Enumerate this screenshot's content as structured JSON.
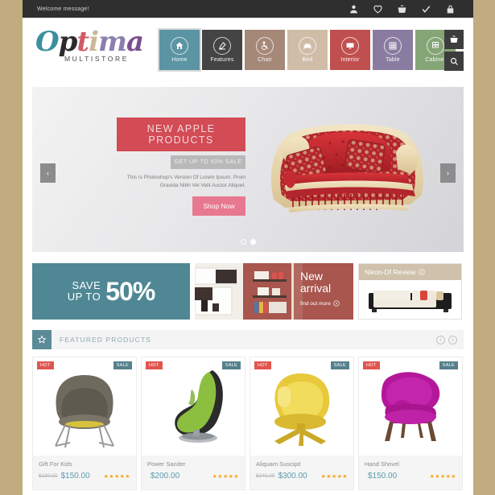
{
  "topbar": {
    "welcome": "Welcome message!",
    "icons": [
      {
        "name": "account-icon"
      },
      {
        "name": "wishlist-heart-icon"
      },
      {
        "name": "shopping-basket-icon"
      },
      {
        "name": "checkout-check-icon"
      },
      {
        "name": "login-lock-icon"
      }
    ]
  },
  "logo": {
    "letters": [
      "O",
      "p",
      "t",
      "i",
      "m",
      "a"
    ],
    "word": "Optima",
    "subtitle": "MULTISTORE"
  },
  "nav": {
    "items": [
      {
        "label": "Home",
        "icon": "home-icon",
        "color": "#5b94a3",
        "active": true
      },
      {
        "label": "Features",
        "icon": "edit-pencil-icon",
        "color": "#444444",
        "active": false
      },
      {
        "label": "Chair",
        "icon": "wheelchair-icon",
        "color": "#a68879",
        "active": false
      },
      {
        "label": "Bed",
        "icon": "bed-icon",
        "color": "#cfbda8",
        "active": false
      },
      {
        "label": "Interior",
        "icon": "monitor-icon",
        "color": "#c0504f",
        "active": false
      },
      {
        "label": "Table",
        "icon": "grid-table-icon",
        "color": "#8a7ca0",
        "active": false
      },
      {
        "label": "Cabinet",
        "icon": "cabinet-icon",
        "color": "#85a577",
        "active": false
      }
    ],
    "buttons": [
      {
        "name": "cart-button",
        "icon": "shopping-basket-icon"
      },
      {
        "name": "search-button",
        "icon": "search-icon"
      }
    ]
  },
  "hero": {
    "title": "NEW APPLE PRODUCTS",
    "subtitle": "GET UP TO 50% SALE",
    "body": "This Is Photoshop's Version Of Lorem Ipsum. Proin Gravida Nibh Vel Velit Auctor Aliquet.",
    "cta": "Shop Now",
    "prev": "‹",
    "next": "›",
    "dots": 2,
    "active_dot": 2,
    "image_alt": "red-ornate-sofa"
  },
  "promos": {
    "save": {
      "small_line1": "SAVE",
      "small_line2": "UP TO",
      "big": "50%",
      "color": "#4f8794"
    },
    "new_arrival": {
      "line1": "New",
      "line2": "arrival",
      "link": "find out more",
      "color": "#a8564e"
    },
    "nikon": {
      "title": "Nikon-Df Review",
      "image_alt": "black-white-modern-sofa"
    }
  },
  "featured": {
    "title": "FEATURED PRODUCTS",
    "star_icon": "star-icon",
    "prev": "‹",
    "next": "›"
  },
  "products": [
    {
      "name": "Gift For Kids",
      "old_price": "$180.00",
      "price": "$150.00",
      "badge_hot": "HOT",
      "badge_sale": "SALE",
      "stars": "★★★★★",
      "image_alt": "grey-womb-armchair"
    },
    {
      "name": "Power Sander",
      "old_price": "",
      "price": "$200.00",
      "badge_hot": "HOT",
      "badge_sale": "SALE",
      "stars": "★★★★★",
      "image_alt": "green-lounge-chair"
    },
    {
      "name": "Aliquam Suscipit",
      "old_price": "$340.00",
      "price": "$300.00",
      "badge_hot": "HOT",
      "badge_sale": "SALE",
      "stars": "★★★★★",
      "image_alt": "yellow-swivel-chair"
    },
    {
      "name": "Hand Shovel",
      "old_price": "",
      "price": "$150.00",
      "badge_hot": "HOT",
      "badge_sale": "SALE",
      "stars": "★★★★★",
      "image_alt": "magenta-pelican-chair"
    }
  ],
  "colors": {
    "page_bg": "#c3ab80",
    "topbar_bg": "#2f2f2f",
    "accent_teal": "#5b8b97",
    "accent_red": "#d24b55",
    "accent_pink": "#e8788f"
  }
}
